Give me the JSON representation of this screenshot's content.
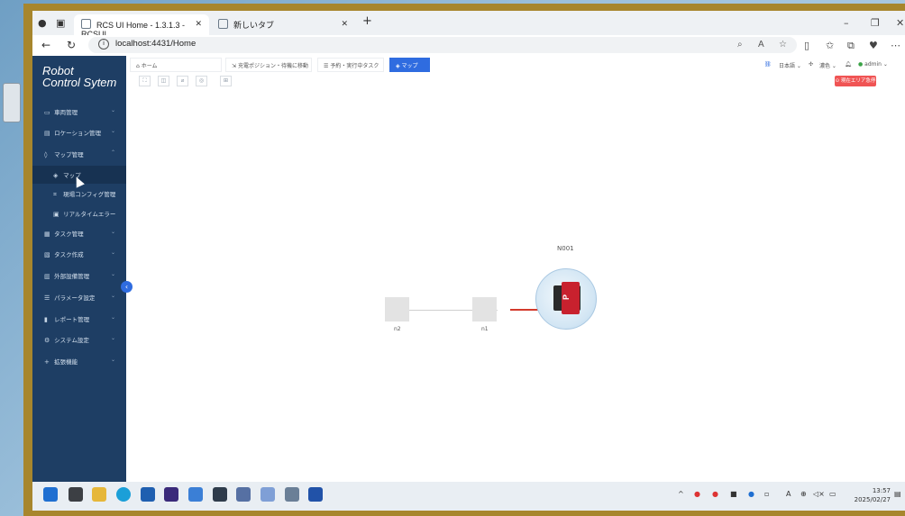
{
  "browser": {
    "tabs": [
      {
        "title": "RCS UI Home - 1.3.1.3 - RCSUI",
        "active": true
      },
      {
        "title": "新しいタブ",
        "active": false
      }
    ],
    "new_tab": "+",
    "url": "localhost:4431/Home"
  },
  "app": {
    "brand_line1": "Robot",
    "brand_line2": "Control Sytem",
    "page_tabs": [
      {
        "label": "ホーム",
        "icon": "home-icon"
      },
      {
        "label": "充電ポジション・待機に移動",
        "icon": "move-icon"
      },
      {
        "label": "予約・実行中タスク",
        "icon": "task-icon"
      },
      {
        "label": "マップ",
        "icon": "map-icon",
        "active": true
      }
    ],
    "language": "日本語",
    "theme": "濃色",
    "user": "admin",
    "stop_button": "現在エリア急停止",
    "sidebar": [
      {
        "label": "車両管理",
        "icon": "vehicle-icon",
        "sub": false
      },
      {
        "label": "ロケーション管理",
        "icon": "location-icon",
        "sub": false
      },
      {
        "label": "マップ管理",
        "icon": "map-manage-icon",
        "sub": false
      },
      {
        "label": "マップ",
        "icon": "map-icon",
        "sub": true,
        "selected": true
      },
      {
        "label": "現場コンフィグ管理",
        "icon": "config-icon",
        "sub": true
      },
      {
        "label": "リアルタイムエラー",
        "icon": "error-icon",
        "sub": true
      },
      {
        "label": "タスク管理",
        "icon": "task-manage-icon",
        "sub": false
      },
      {
        "label": "タスク作成",
        "icon": "task-create-icon",
        "sub": false
      },
      {
        "label": "外部設備管理",
        "icon": "device-icon",
        "sub": false
      },
      {
        "label": "パラメータ設定",
        "icon": "param-icon",
        "sub": false
      },
      {
        "label": "レポート管理",
        "icon": "report-icon",
        "sub": false
      },
      {
        "label": "システム設定",
        "icon": "system-icon",
        "sub": false
      },
      {
        "label": "拡張機能",
        "icon": "plus-icon",
        "sub": false
      }
    ],
    "map": {
      "robot_label": "N001",
      "nodes": [
        "n2",
        "n1"
      ],
      "robot_badge": "P"
    }
  },
  "taskbar": {
    "time": "13:57",
    "date": "2025/02/27"
  }
}
